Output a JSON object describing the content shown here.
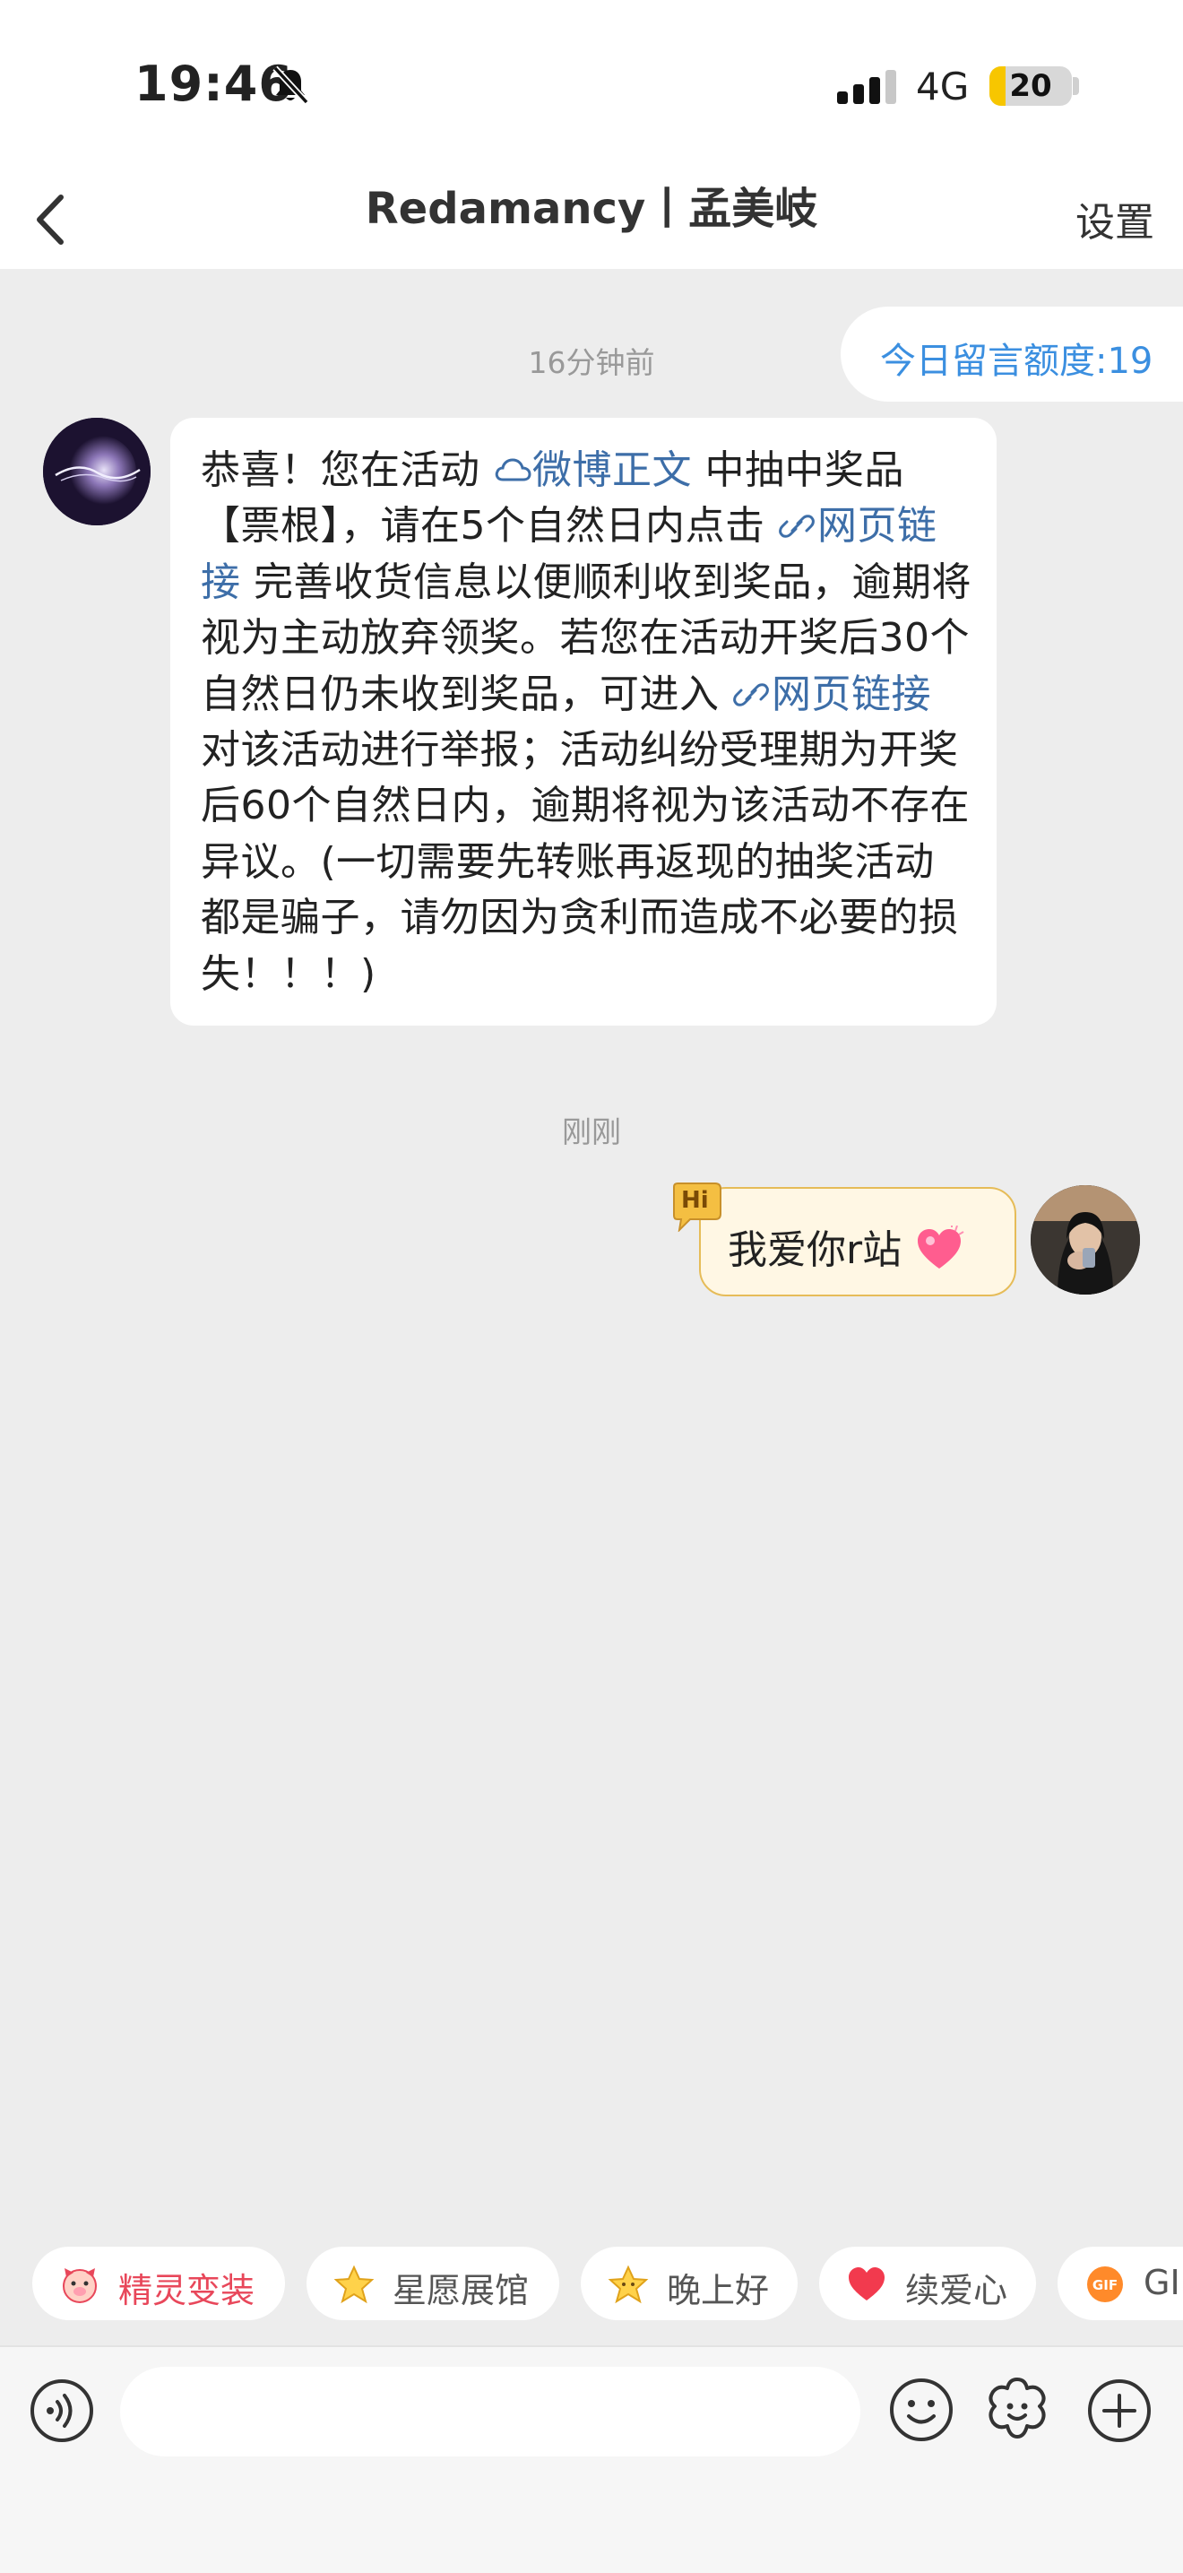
{
  "status_bar": {
    "time": "19:46",
    "network": "4G",
    "battery": "20",
    "battery_level_pct": 20
  },
  "nav": {
    "title": "Redamancy丨孟美岐",
    "settings_label": "设置"
  },
  "quota_label": "今日留言额度:19",
  "messages": [
    {
      "timestamp": "16分钟前",
      "direction": "incoming",
      "segments": [
        {
          "text": "恭喜！您在活动 "
        },
        {
          "text": "微博正文",
          "link": true,
          "icon": "cloud-icon"
        },
        {
          "text": " 中抽中奖品【票根】，请在5个自然日内点击 "
        },
        {
          "text": "网页链接",
          "link": true,
          "icon": "link-icon"
        },
        {
          "text": " 完善收货信息以便顺利收到奖品，逾期将视为主动放弃领奖。若您在活动开奖后30个自然日仍未收到奖品，可进入 "
        },
        {
          "text": "网页链接",
          "link": true,
          "icon": "link-icon"
        },
        {
          "text": " 对该活动进行举报；活动纠纷受理期为开奖后60个自然日内，逾期将视为该活动不存在异议。(一切需要先转账再返现的抽奖活动都是骗子，请勿因为贪利而造成不必要的损失！！！)"
        }
      ]
    },
    {
      "timestamp": "刚刚",
      "direction": "outgoing",
      "text": "我爱你r站",
      "badge": "Hi"
    }
  ],
  "quick_actions": [
    {
      "label": "精灵变装",
      "icon": "pig-icon",
      "color": "#e8475a"
    },
    {
      "label": "星愿展馆",
      "icon": "star-icon",
      "color": "#555555"
    },
    {
      "label": "晚上好",
      "icon": "star-icon",
      "color": "#555555"
    },
    {
      "label": "续爱心",
      "icon": "heart-icon",
      "color": "#555555"
    },
    {
      "label": "GI",
      "icon": "gif-icon",
      "color": "#555555"
    }
  ],
  "colors": {
    "link": "#3d6ea8",
    "quota_text": "#3b8fe0",
    "battery": "#f7c600",
    "outgoing_bubble_bg": "#fff7e4",
    "outgoing_bubble_border": "#e6bc58"
  }
}
